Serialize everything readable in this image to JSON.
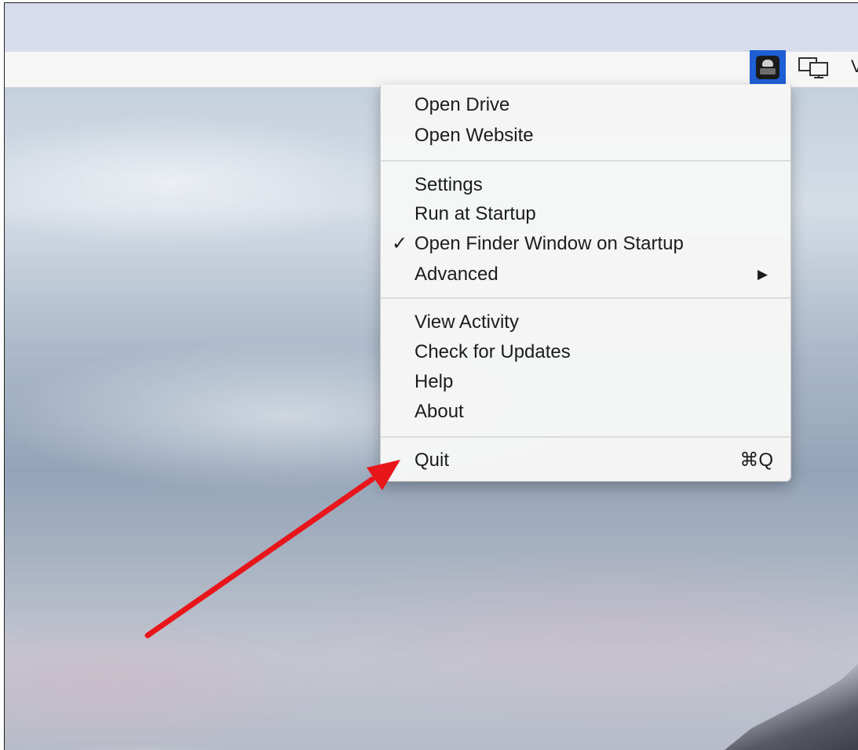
{
  "colors": {
    "menubar_bg": "#f6f6f6",
    "title_strip_bg": "#d7dcec",
    "menu_highlight_icon_bg": "#1f5fd6",
    "annotation_arrow": "#e8161b"
  },
  "menubar": {
    "extras": [
      {
        "icon": "drive-app-icon",
        "selected": true
      },
      {
        "icon": "display-mirroring-icon"
      },
      {
        "icon": "cut-off-item",
        "text": "V"
      }
    ]
  },
  "menu": {
    "groups": [
      {
        "items": [
          {
            "label": "Open Drive"
          },
          {
            "label": "Open Website"
          }
        ]
      },
      {
        "items": [
          {
            "label": "Settings"
          },
          {
            "label": "Run at Startup"
          },
          {
            "label": "Open Finder Window on Startup",
            "checked": true,
            "check_mark": "✓"
          },
          {
            "label": "Advanced",
            "submenu": true,
            "submenu_arrow": "▶"
          }
        ]
      },
      {
        "items": [
          {
            "label": "View Activity"
          },
          {
            "label": "Check for Updates"
          },
          {
            "label": "Help"
          },
          {
            "label": "About"
          }
        ]
      },
      {
        "items": [
          {
            "label": "Quit",
            "shortcut": "⌘Q"
          }
        ]
      }
    ]
  },
  "annotation": {
    "type": "arrow",
    "points_to": "Quit"
  }
}
